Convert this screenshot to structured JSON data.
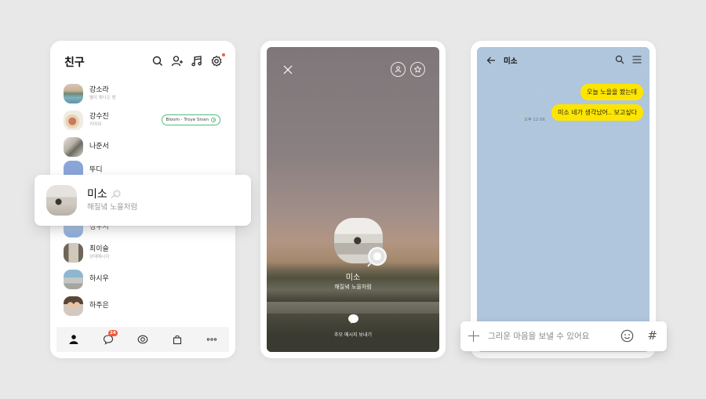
{
  "friends_panel": {
    "title": "친구",
    "header_icons": [
      "search-icon",
      "add-friend-icon",
      "music-icon",
      "settings-icon"
    ],
    "friends": [
      {
        "name": "강소라",
        "status": "별이 빛나는 밤",
        "avatar": "lake-photo"
      },
      {
        "name": "강수진",
        "status": "귀여워",
        "avatar": "cake-photo",
        "music": "Bloom - Troye Sivan"
      },
      {
        "name": "나준서",
        "status": "",
        "avatar": "man-photo"
      },
      {
        "name": "뚜디",
        "status": "",
        "avatar": "default-blue"
      },
      {
        "name": "성우시",
        "status": "",
        "avatar": "default-blue"
      },
      {
        "name": "최이슬",
        "status": "상태메시지",
        "avatar": "hallway-photo"
      },
      {
        "name": "하시우",
        "status": "",
        "avatar": "street-photo"
      },
      {
        "name": "하주은",
        "status": "",
        "avatar": "selfie-photo"
      }
    ],
    "highlighted_friend": {
      "name": "미소",
      "status": "해질녘 노을처럼"
    },
    "tabs": [
      {
        "name": "friends-tab",
        "icon": "person-icon"
      },
      {
        "name": "chats-tab",
        "icon": "chat-bubble-icon",
        "badge": "24"
      },
      {
        "name": "view-tab",
        "icon": "eye-icon"
      },
      {
        "name": "shopping-tab",
        "icon": "shopping-bag-icon"
      },
      {
        "name": "more-tab",
        "icon": "more-icon"
      }
    ]
  },
  "memorial_panel": {
    "top_icons": [
      "close-icon",
      "switch-profile-icon",
      "star-icon"
    ],
    "name": "미소",
    "status": "해질녘 노을처럼",
    "send_label": "추모 메시지 보내기"
  },
  "chat_panel": {
    "title": "미소",
    "messages": [
      {
        "text": "오늘 노을을 봤는데",
        "read": "1"
      },
      {
        "text": "미소 네가 생각났어.. 보고싶다",
        "read": "1",
        "time": "오후 12:06"
      }
    ],
    "input": {
      "placeholder": "그리운 마음을 보낼 수 있어요",
      "value": ""
    }
  },
  "colors": {
    "background": "#e8e8e8",
    "chat_background": "#b0c6dc",
    "bubble": "#fee500",
    "music_pill_border": "#4cbf7a",
    "badge": "#f05a3a"
  }
}
